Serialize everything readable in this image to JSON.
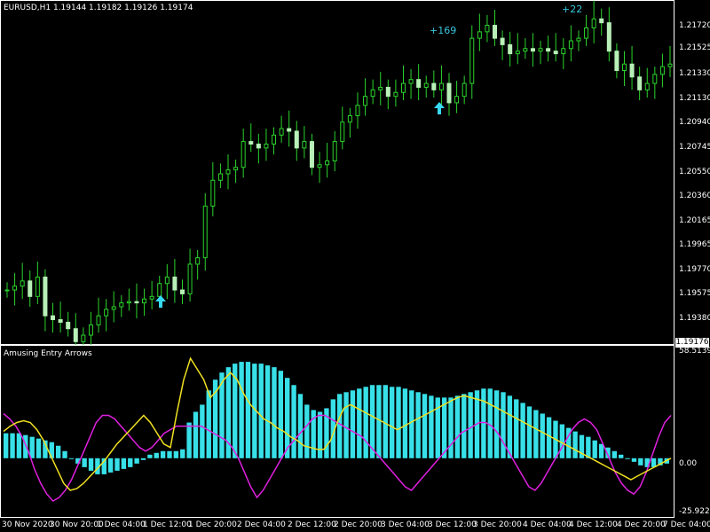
{
  "header": {
    "symbol_info": "EURUSD,H1  1.19144 1.19182 1.19126 1.19174"
  },
  "indicator": {
    "name": "Amusing Entry Arrows",
    "max_label": "58.5139",
    "zero_label": "0.00",
    "min_label": "-25.9229"
  },
  "price_axis": {
    "labels": [
      "1.21720",
      "1.21525",
      "1.21330",
      "1.21130",
      "1.20940",
      "1.20745",
      "1.20550",
      "1.20360",
      "1.20165",
      "1.19965",
      "1.19770",
      "1.19575",
      "1.19380"
    ],
    "current_price": "1.19176"
  },
  "time_axis": {
    "labels": [
      "30 Nov 2020",
      "30 Nov 20:00",
      "1 Dec 04:00",
      "1 Dec 12:00",
      "1 Dec 20:00",
      "2 Dec 04:00",
      "2 Dec 12:00",
      "2 Dec 20:00",
      "3 Dec 04:00",
      "3 Dec 12:00",
      "3 Dec 20:00",
      "4 Dec 04:00",
      "4 Dec 12:00",
      "4 Dec 20:00",
      "7 Dec 04:00"
    ]
  },
  "annotations": {
    "profit_1": "+169",
    "profit_2": "+22"
  },
  "colors": {
    "candle": "#2bd42b",
    "histogram": "#38e0e8",
    "fast_line": "#f0e020",
    "slow_line": "#e020e0",
    "arrow": "#38d8f0"
  },
  "chart_data": [
    {
      "type": "candlestick",
      "symbol": "EURUSD",
      "timeframe": "H1",
      "close_series": [
        1.1965,
        1.1968,
        1.1972,
        1.196,
        1.1975,
        1.1945,
        1.1942,
        1.194,
        1.1935,
        1.1925,
        1.193,
        1.1938,
        1.1945,
        1.195,
        1.1952,
        1.1955,
        1.1956,
        1.1955,
        1.1958,
        1.196,
        1.197,
        1.1975,
        1.1965,
        1.1962,
        1.1985,
        1.199,
        1.203,
        1.205,
        1.2055,
        1.2058,
        1.206,
        1.208,
        1.2078,
        1.2075,
        1.2078,
        1.2085,
        1.209,
        1.2088,
        1.2075,
        1.208,
        1.206,
        1.2062,
        1.2065,
        1.208,
        1.2095,
        1.21,
        1.2108,
        1.2115,
        1.212,
        1.2122,
        1.2115,
        1.2118,
        1.2125,
        1.2128,
        1.2122,
        1.2125,
        1.212,
        1.2125,
        1.211,
        1.2115,
        1.2125,
        1.216,
        1.2165,
        1.217,
        1.216,
        1.2155,
        1.2148,
        1.215,
        1.2152,
        1.215,
        1.2152,
        1.215,
        1.2148,
        1.2152,
        1.2158,
        1.216,
        1.2168,
        1.2175,
        1.2172,
        1.215,
        1.2135,
        1.214,
        1.213,
        1.212,
        1.2125,
        1.2132,
        1.2138,
        1.214
      ],
      "ylim": [
        1.193,
        1.218
      ]
    },
    {
      "type": "bar",
      "name": "Amusing Entry Arrows",
      "ylim": [
        -25.9229,
        58.5139
      ],
      "histogram": [
        14,
        14,
        14,
        13,
        12,
        11,
        10,
        9,
        7,
        4,
        0,
        -3,
        -5,
        -7,
        -9,
        -9,
        -8,
        -7,
        -6,
        -5,
        -3,
        -1,
        2,
        3,
        4,
        4,
        4,
        5,
        20,
        26,
        30,
        38,
        44,
        48,
        51,
        53,
        54,
        54,
        53,
        53,
        52,
        51,
        49,
        45,
        41,
        36,
        30,
        27,
        26,
        28,
        33,
        36,
        37,
        38,
        39,
        40,
        41,
        41,
        41,
        40,
        40,
        39,
        38,
        37,
        36,
        35,
        34,
        34,
        34,
        35,
        36,
        37,
        38,
        39,
        39,
        38,
        37,
        35,
        33,
        31,
        29,
        27,
        25,
        23,
        21,
        19,
        17,
        15,
        13,
        12,
        10,
        8,
        6,
        4,
        2,
        0,
        -2,
        -4,
        -5,
        -5,
        -4,
        -3
      ],
      "fast_line": [
        15,
        18,
        20,
        21,
        20,
        16,
        10,
        2,
        -6,
        -14,
        -18,
        -17,
        -14,
        -10,
        -6,
        -2,
        3,
        8,
        12,
        16,
        20,
        24,
        20,
        14,
        8,
        6,
        26,
        44,
        56,
        50,
        44,
        34,
        38,
        44,
        48,
        44,
        36,
        30,
        26,
        22,
        20,
        17,
        15,
        12,
        10,
        7,
        6,
        5,
        5,
        10,
        20,
        28,
        30,
        28,
        26,
        24,
        22,
        20,
        18,
        16,
        18,
        20,
        22,
        24,
        26,
        28,
        30,
        32,
        34,
        35,
        34,
        33,
        32,
        30,
        28,
        26,
        24,
        22,
        20,
        18,
        16,
        14,
        12,
        10,
        8,
        6,
        4,
        2,
        0,
        -2,
        -4,
        -6,
        -8,
        -10,
        -12,
        -10,
        -8,
        -6,
        -4,
        -2,
        0
      ],
      "slow_line": [
        25,
        22,
        18,
        12,
        4,
        -6,
        -14,
        -20,
        -24,
        -22,
        -18,
        -12,
        -4,
        4,
        12,
        20,
        24,
        24,
        22,
        18,
        14,
        10,
        6,
        4,
        6,
        10,
        14,
        16,
        18,
        18,
        18,
        18,
        18,
        16,
        14,
        12,
        10,
        6,
        0,
        -8,
        -16,
        -22,
        -18,
        -12,
        -6,
        0,
        6,
        10,
        14,
        18,
        22,
        24,
        24,
        22,
        20,
        18,
        16,
        14,
        12,
        8,
        4,
        0,
        -4,
        -8,
        -12,
        -16,
        -18,
        -14,
        -10,
        -6,
        -2,
        2,
        6,
        10,
        14,
        16,
        18,
        20,
        20,
        18,
        14,
        8,
        2,
        -4,
        -10,
        -16,
        -18,
        -14,
        -8,
        -2,
        4,
        10,
        16,
        20,
        22,
        20,
        16,
        8,
        0,
        -8,
        -14,
        -18,
        -20,
        -16,
        -8,
        2,
        12,
        20,
        24
      ]
    }
  ]
}
